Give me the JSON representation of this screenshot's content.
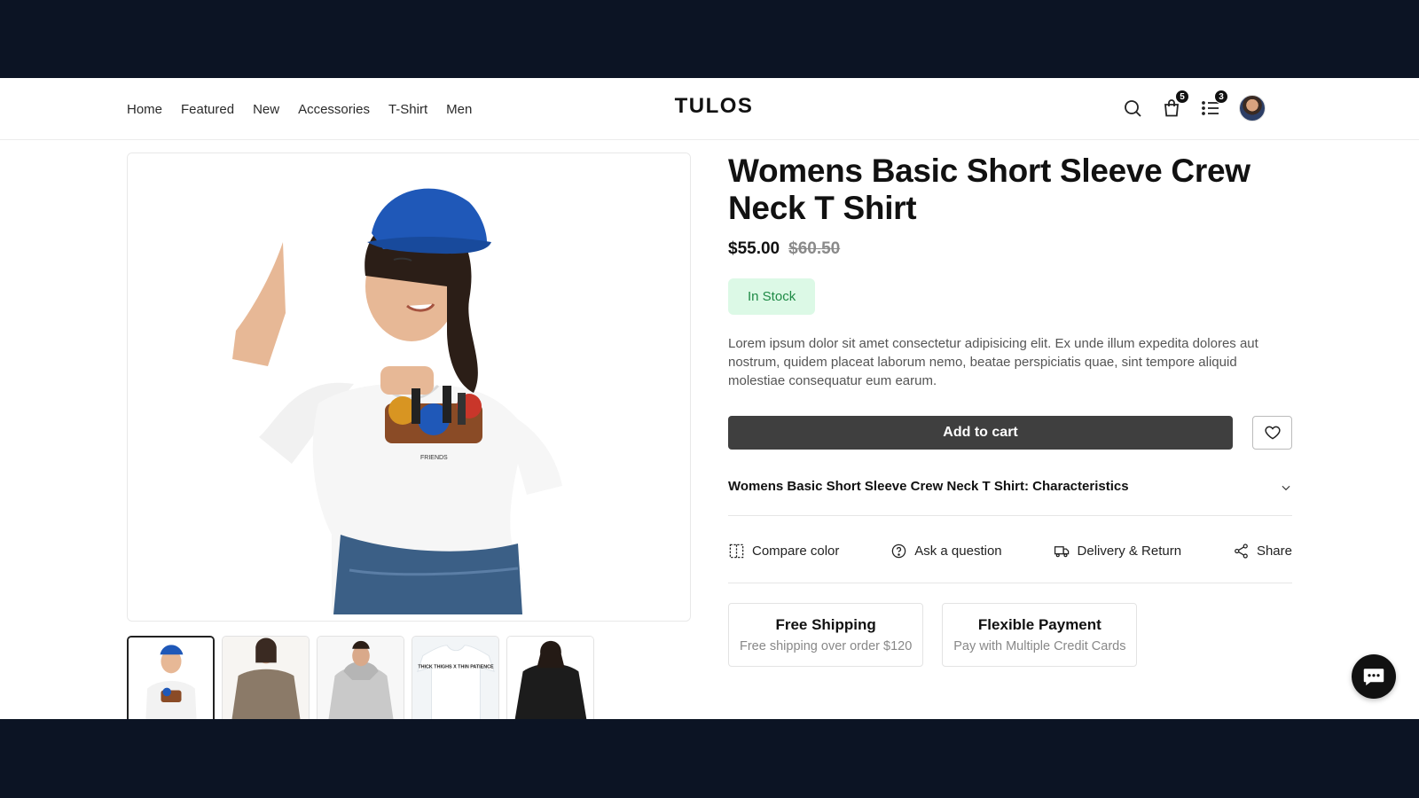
{
  "header": {
    "nav": [
      "Home",
      "Featured",
      "New",
      "Accessories",
      "T-Shirt",
      "Men"
    ],
    "logo": "TULOS",
    "cart_count": "5",
    "list_count": "3"
  },
  "product": {
    "title": "Womens Basic Short Sleeve Crew Neck T Shirt",
    "price": "$55.00",
    "old_price": "$60.50",
    "stock": "In Stock",
    "description": "Lorem ipsum dolor sit amet consectetur adipisicing elit. Ex unde illum expedita dolores aut nostrum, quidem placeat laborum nemo, beatae perspiciatis quae, sint tempore aliquid molestiae consequatur eum earum.",
    "add_to_cart": "Add to cart",
    "characteristics": "Womens Basic Short Sleeve Crew Neck T Shirt: Characteristics"
  },
  "actions": [
    "Compare color",
    "Ask a question",
    "Delivery & Return",
    "Share"
  ],
  "features": [
    {
      "title": "Free Shipping",
      "subtitle": "Free shipping over order $120"
    },
    {
      "title": "Flexible Payment",
      "subtitle": "Pay with Multiple Credit Cards"
    }
  ],
  "thumbnails": [
    "white-tee-blue-cap",
    "beige-sweater",
    "grey-hoodie",
    "white-print-tee",
    "black-long-sleeve"
  ],
  "thumb_text": "THICK THIGHS X THIN PATIENCE",
  "colors": {
    "accent": "#3f3f3f",
    "stock_bg": "#dcf9e6",
    "stock_text": "#1e8a45",
    "frame": "#0c1424"
  }
}
